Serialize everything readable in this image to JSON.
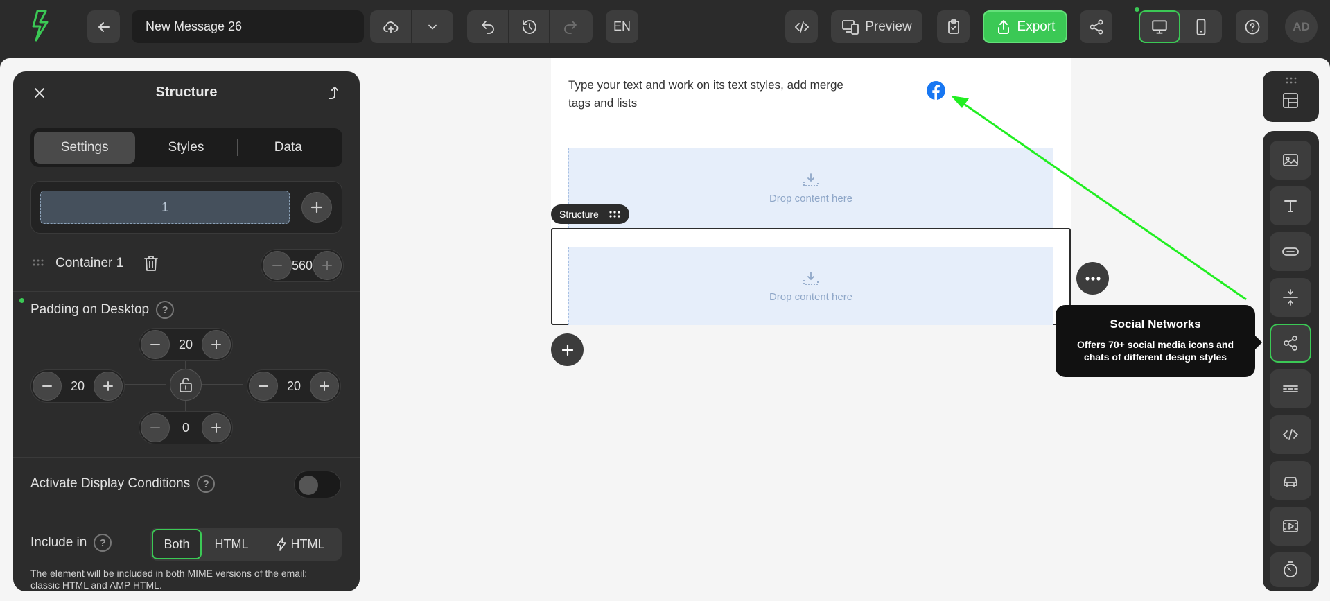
{
  "topbar": {
    "message_title": "New Message 26",
    "language": "EN",
    "preview_label": "Preview",
    "export_label": "Export",
    "avatar_initials": "AD"
  },
  "panel": {
    "title": "Structure",
    "tabs": [
      "Settings",
      "Styles",
      "Data"
    ],
    "active_tab": "Settings",
    "column_label": "1",
    "container_label": "Container 1",
    "container_width": "560",
    "padding_label": "Padding on Desktop",
    "padding": {
      "top": "20",
      "left": "20",
      "right": "20",
      "bottom": "0"
    },
    "display_conditions_label": "Activate Display Conditions",
    "display_conditions_on": false,
    "include_label": "Include in",
    "include_options": [
      "Both",
      "HTML",
      "HTML"
    ],
    "include_selected": "Both",
    "include_note": "The element will be included in both MIME versions of the email: classic HTML and AMP HTML."
  },
  "email": {
    "text_block": "Type your text and work on its text styles, add merge tags and lists",
    "drop_label_1": "Drop content here",
    "drop_label_2": "Drop content here",
    "structure_tag": "Structure"
  },
  "tooltip": {
    "title": "Social Networks",
    "body": "Offers 70+ social media icons and chats of different design styles"
  },
  "right_toolbar": {
    "items": [
      "image-icon",
      "text-icon",
      "button-icon",
      "spacer-icon",
      "social-icon",
      "menu-icon",
      "html-icon",
      "product-icon",
      "video-icon",
      "timer-icon"
    ],
    "active_item": "social-icon"
  },
  "colors": {
    "accent_green": "#3bc955",
    "topbar_bg": "#2b2b2b",
    "panel_bg": "#2c2c2c",
    "canvas_bg": "#f5f5f5",
    "drop_zone_bg": "#e6eefa",
    "facebook_blue": "#1877f2",
    "annotation_arrow": "#22ee22"
  }
}
